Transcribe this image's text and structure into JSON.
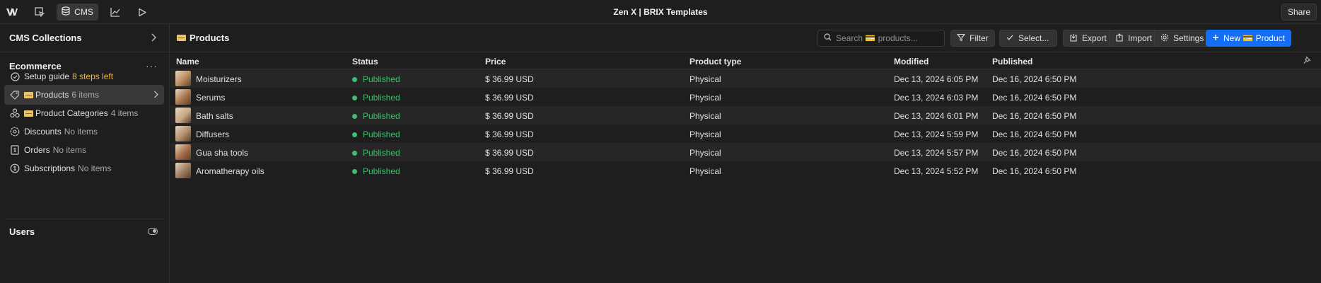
{
  "topbar": {
    "title": "Zen X | BRIX Templates",
    "cms_label": "CMS",
    "share_label": "Share",
    "icons": [
      "webflow-logo-icon",
      "designer-icon",
      "database-icon",
      "analyze-icon",
      "preview-play-icon"
    ]
  },
  "sidebar": {
    "collections_title": "CMS Collections",
    "ecommerce_title": "Ecommerce",
    "items": [
      {
        "label": "Setup guide",
        "extra": "8 steps left",
        "icon": "check-circle-icon"
      },
      {
        "label": "Products",
        "count": "6 items",
        "icon": "tag-icon"
      },
      {
        "label": "Product Categories",
        "count": "4 items",
        "icon": "categories-icon"
      },
      {
        "label": "Discounts",
        "count": "No items",
        "icon": "discount-icon"
      },
      {
        "label": "Orders",
        "count": "No items",
        "icon": "receipt-icon"
      },
      {
        "label": "Subscriptions",
        "count": "No items",
        "icon": "subscription-icon"
      }
    ],
    "users_title": "Users"
  },
  "main": {
    "title": "Products",
    "search_placeholder": "Search 💳 products...",
    "buttons": {
      "filter": "Filter",
      "select": "Select...",
      "export": "Export",
      "import": "Import",
      "settings": "Settings",
      "new": "New 💳 Product"
    },
    "columns": [
      "Name",
      "Status",
      "Price",
      "Product type",
      "Modified",
      "Published"
    ],
    "rows": [
      {
        "name": "Moisturizers",
        "status": "Published",
        "price": "$ 36.99 USD",
        "type": "Physical",
        "modified": "Dec 13, 2024 6:05 PM",
        "published": "Dec 16, 2024 6:50 PM",
        "thumb": "#b98a5e"
      },
      {
        "name": "Serums",
        "status": "Published",
        "price": "$ 36.99 USD",
        "type": "Physical",
        "modified": "Dec 13, 2024 6:03 PM",
        "published": "Dec 16, 2024 6:50 PM",
        "thumb": "#a8744a"
      },
      {
        "name": "Bath salts",
        "status": "Published",
        "price": "$ 36.99 USD",
        "type": "Physical",
        "modified": "Dec 13, 2024 6:01 PM",
        "published": "Dec 16, 2024 6:50 PM",
        "thumb": "#c9a888"
      },
      {
        "name": "Diffusers",
        "status": "Published",
        "price": "$ 36.99 USD",
        "type": "Physical",
        "modified": "Dec 13, 2024 5:59 PM",
        "published": "Dec 16, 2024 6:50 PM",
        "thumb": "#b38d6a"
      },
      {
        "name": "Gua sha tools",
        "status": "Published",
        "price": "$ 36.99 USD",
        "type": "Physical",
        "modified": "Dec 13, 2024 5:57 PM",
        "published": "Dec 16, 2024 6:50 PM",
        "thumb": "#a66a47"
      },
      {
        "name": "Aromatherapy oils",
        "status": "Published",
        "price": "$ 36.99 USD",
        "type": "Physical",
        "modified": "Dec 13, 2024 5:52 PM",
        "published": "Dec 16, 2024 6:50 PM",
        "thumb": "#9c7b5e"
      }
    ]
  },
  "colors": {
    "accent": "#146ef5",
    "published": "#3fbf6f",
    "steps_left": "#f5b73b"
  }
}
